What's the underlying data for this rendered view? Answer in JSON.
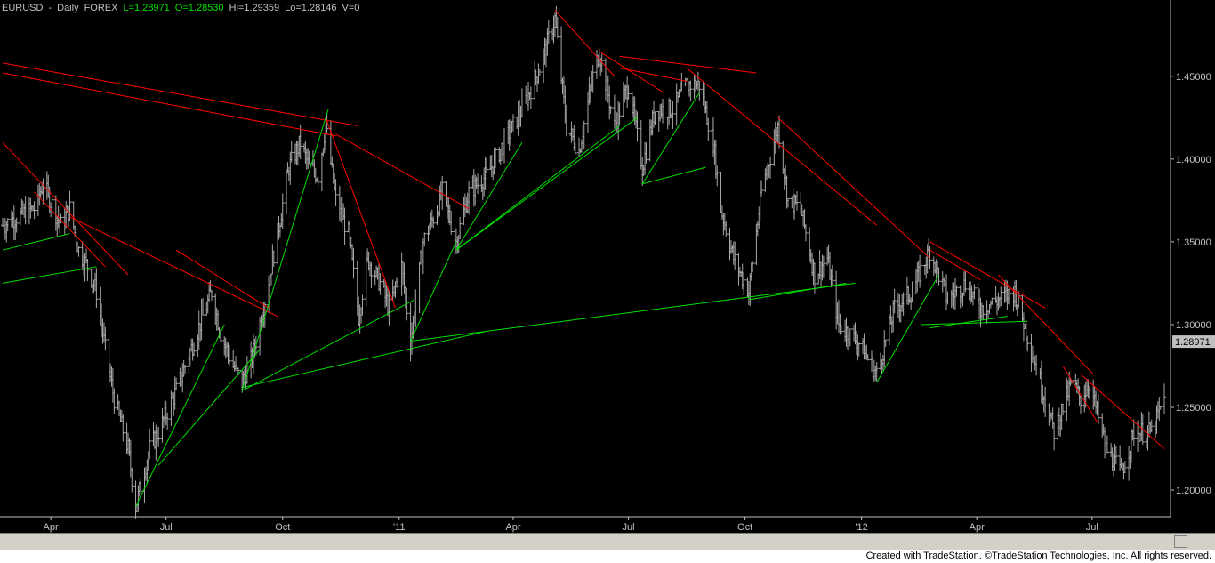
{
  "header": {
    "symbol": "EURUSD",
    "sep1": "-",
    "interval": "Daily",
    "exchange": "FOREX",
    "last": "L=1.28971",
    "open": "O=1.28530",
    "high": "Hi=1.29359",
    "low": "Lo=1.28146",
    "volume": "V=0"
  },
  "footer": {
    "credit": "Created with TradeStation. ©TradeStation Technologies, Inc. All rights reserved."
  },
  "colors": {
    "background": "#000000",
    "bars": "#a8a8a8",
    "resistance": "#ff0000",
    "support": "#00e000",
    "axis": "#c0c0c0"
  },
  "chart_data": {
    "type": "ohlc",
    "title": "",
    "xlabel": "",
    "ylabel": "",
    "ylim": [
      1.185,
      1.495
    ],
    "xlim": [
      "2010-02-22",
      "2012-08-27"
    ],
    "yticks": [
      1.2,
      1.25,
      1.3,
      1.35,
      1.4,
      1.45
    ],
    "ytick_labels": [
      "1.20000",
      "1.25000",
      "1.30000",
      "1.35000",
      "1.40000",
      "1.45000"
    ],
    "last_price_label": "1.28971",
    "last_price": 1.28971,
    "xticks": [
      {
        "date": "2010-04-01",
        "label": "Apr"
      },
      {
        "date": "2010-07-01",
        "label": "Jul"
      },
      {
        "date": "2010-10-01",
        "label": "Oct"
      },
      {
        "date": "2011-01-01",
        "label": "'11"
      },
      {
        "date": "2011-04-01",
        "label": "Apr"
      },
      {
        "date": "2011-07-01",
        "label": "Jul"
      },
      {
        "date": "2011-10-01",
        "label": "Oct"
      },
      {
        "date": "2012-01-01",
        "label": "'12"
      },
      {
        "date": "2012-04-01",
        "label": "Apr"
      },
      {
        "date": "2012-07-01",
        "label": "Jul"
      }
    ],
    "price_path": [
      [
        "2010-02-22",
        1.36
      ],
      [
        "2010-03-05",
        1.365
      ],
      [
        "2010-03-19",
        1.37
      ],
      [
        "2010-03-26",
        1.385
      ],
      [
        "2010-04-09",
        1.36
      ],
      [
        "2010-04-16",
        1.37
      ],
      [
        "2010-04-23",
        1.345
      ],
      [
        "2010-04-30",
        1.335
      ],
      [
        "2010-05-07",
        1.32
      ],
      [
        "2010-05-14",
        1.285
      ],
      [
        "2010-05-21",
        1.255
      ],
      [
        "2010-06-01",
        1.225
      ],
      [
        "2010-06-07",
        1.19
      ],
      [
        "2010-06-18",
        1.225
      ],
      [
        "2010-06-25",
        1.235
      ],
      [
        "2010-07-09",
        1.26
      ],
      [
        "2010-07-23",
        1.29
      ],
      [
        "2010-08-06",
        1.32
      ],
      [
        "2010-08-13",
        1.295
      ],
      [
        "2010-08-23",
        1.275
      ],
      [
        "2010-08-30",
        1.265
      ],
      [
        "2010-09-07",
        1.28
      ],
      [
        "2010-09-17",
        1.315
      ],
      [
        "2010-09-27",
        1.355
      ],
      [
        "2010-10-06",
        1.395
      ],
      [
        "2010-10-15",
        1.41
      ],
      [
        "2010-10-22",
        1.395
      ],
      [
        "2010-10-29",
        1.39
      ],
      [
        "2010-11-04",
        1.42
      ],
      [
        "2010-11-12",
        1.375
      ],
      [
        "2010-11-22",
        1.355
      ],
      [
        "2010-11-30",
        1.305
      ],
      [
        "2010-12-07",
        1.34
      ],
      [
        "2010-12-17",
        1.325
      ],
      [
        "2010-12-24",
        1.31
      ],
      [
        "2011-01-03",
        1.335
      ],
      [
        "2011-01-10",
        1.29
      ],
      [
        "2011-01-20",
        1.35
      ],
      [
        "2011-01-31",
        1.37
      ],
      [
        "2011-02-04",
        1.38
      ],
      [
        "2011-02-15",
        1.35
      ],
      [
        "2011-02-25",
        1.38
      ],
      [
        "2011-03-11",
        1.39
      ],
      [
        "2011-03-25",
        1.41
      ],
      [
        "2011-04-08",
        1.43
      ],
      [
        "2011-04-22",
        1.455
      ],
      [
        "2011-05-04",
        1.485
      ],
      [
        "2011-05-13",
        1.42
      ],
      [
        "2011-05-23",
        1.405
      ],
      [
        "2011-06-03",
        1.45
      ],
      [
        "2011-06-08",
        1.465
      ],
      [
        "2011-06-20",
        1.42
      ],
      [
        "2011-07-01",
        1.445
      ],
      [
        "2011-07-12",
        1.395
      ],
      [
        "2011-07-22",
        1.43
      ],
      [
        "2011-08-05",
        1.43
      ],
      [
        "2011-08-16",
        1.445
      ],
      [
        "2011-08-26",
        1.445
      ],
      [
        "2011-09-06",
        1.41
      ],
      [
        "2011-09-12",
        1.37
      ],
      [
        "2011-09-22",
        1.34
      ],
      [
        "2011-10-04",
        1.32
      ],
      [
        "2011-10-14",
        1.38
      ],
      [
        "2011-10-27",
        1.42
      ],
      [
        "2011-11-04",
        1.375
      ],
      [
        "2011-11-14",
        1.37
      ],
      [
        "2011-11-25",
        1.33
      ],
      [
        "2011-12-05",
        1.34
      ],
      [
        "2011-12-14",
        1.3
      ],
      [
        "2011-12-29",
        1.29
      ],
      [
        "2012-01-13",
        1.27
      ],
      [
        "2012-01-27",
        1.31
      ],
      [
        "2012-02-10",
        1.32
      ],
      [
        "2012-02-24",
        1.345
      ],
      [
        "2012-03-09",
        1.315
      ],
      [
        "2012-03-23",
        1.325
      ],
      [
        "2012-04-04",
        1.31
      ],
      [
        "2012-04-18",
        1.315
      ],
      [
        "2012-05-01",
        1.32
      ],
      [
        "2012-05-14",
        1.285
      ],
      [
        "2012-05-25",
        1.255
      ],
      [
        "2012-06-01",
        1.235
      ],
      [
        "2012-06-15",
        1.265
      ],
      [
        "2012-06-22",
        1.255
      ],
      [
        "2012-06-29",
        1.265
      ],
      [
        "2012-07-12",
        1.225
      ],
      [
        "2012-07-24",
        1.21
      ],
      [
        "2012-08-03",
        1.235
      ],
      [
        "2012-08-17",
        1.235
      ],
      [
        "2012-08-27",
        1.255
      ]
    ],
    "trendlines": {
      "resistance": [
        [
          [
            "2010-02-22",
            1.458
          ],
          [
            "2010-11-30",
            1.42
          ]
        ],
        [
          [
            "2010-02-22",
            1.452
          ],
          [
            "2010-11-12",
            1.414
          ]
        ],
        [
          [
            "2010-02-22",
            1.41
          ],
          [
            "2010-06-01",
            1.33
          ]
        ],
        [
          [
            "2010-03-19",
            1.38
          ],
          [
            "2010-05-14",
            1.335
          ]
        ],
        [
          [
            "2010-04-16",
            1.365
          ],
          [
            "2010-09-27",
            1.305
          ]
        ],
        [
          [
            "2010-07-09",
            1.345
          ],
          [
            "2010-09-20",
            1.31
          ]
        ],
        [
          [
            "2010-11-04",
            1.425
          ],
          [
            "2010-12-29",
            1.31
          ]
        ],
        [
          [
            "2010-11-12",
            1.415
          ],
          [
            "2011-02-25",
            1.37
          ]
        ],
        [
          [
            "2011-05-04",
            1.49
          ],
          [
            "2011-06-20",
            1.45
          ]
        ],
        [
          [
            "2011-06-08",
            1.465
          ],
          [
            "2011-07-29",
            1.44
          ]
        ],
        [
          [
            "2011-06-24",
            1.455
          ],
          [
            "2011-08-16",
            1.447
          ]
        ],
        [
          [
            "2011-06-24",
            1.462
          ],
          [
            "2011-10-10",
            1.452
          ]
        ],
        [
          [
            "2011-08-16",
            1.455
          ],
          [
            "2012-01-13",
            1.36
          ]
        ],
        [
          [
            "2011-10-27",
            1.425
          ],
          [
            "2012-02-24",
            1.34
          ]
        ],
        [
          [
            "2012-02-24",
            1.35
          ],
          [
            "2012-05-25",
            1.31
          ]
        ],
        [
          [
            "2012-02-24",
            1.345
          ],
          [
            "2012-04-04",
            1.327
          ]
        ],
        [
          [
            "2012-04-18",
            1.33
          ],
          [
            "2012-07-02",
            1.27
          ]
        ],
        [
          [
            "2012-06-08",
            1.275
          ],
          [
            "2012-07-06",
            1.24
          ]
        ],
        [
          [
            "2012-06-22",
            1.27
          ],
          [
            "2012-08-27",
            1.225
          ]
        ]
      ],
      "support": [
        [
          [
            "2010-02-22",
            1.345
          ],
          [
            "2010-04-16",
            1.355
          ]
        ],
        [
          [
            "2010-02-22",
            1.325
          ],
          [
            "2010-05-07",
            1.335
          ]
        ],
        [
          [
            "2010-06-07",
            1.19
          ],
          [
            "2010-08-16",
            1.3
          ]
        ],
        [
          [
            "2010-06-25",
            1.215
          ],
          [
            "2010-09-13",
            1.285
          ]
        ],
        [
          [
            "2010-08-30",
            1.26
          ],
          [
            "2011-01-13",
            1.315
          ]
        ],
        [
          [
            "2010-08-30",
            1.262
          ],
          [
            "2011-03-11",
            1.296
          ]
        ],
        [
          [
            "2010-08-30",
            1.26
          ],
          [
            "2010-11-06",
            1.43
          ]
        ],
        [
          [
            "2011-01-10",
            1.29
          ],
          [
            "2011-02-15",
            1.35
          ]
        ],
        [
          [
            "2011-01-10",
            1.29
          ],
          [
            "2011-12-27",
            1.325
          ]
        ],
        [
          [
            "2011-02-15",
            1.345
          ],
          [
            "2011-04-08",
            1.41
          ]
        ],
        [
          [
            "2011-02-15",
            1.345
          ],
          [
            "2011-07-08",
            1.425
          ]
        ],
        [
          [
            "2011-02-15",
            1.345
          ],
          [
            "2011-06-24",
            1.42
          ]
        ],
        [
          [
            "2011-07-12",
            1.385
          ],
          [
            "2011-08-31",
            1.395
          ]
        ],
        [
          [
            "2011-07-12",
            1.385
          ],
          [
            "2011-08-26",
            1.44
          ]
        ],
        [
          [
            "2011-10-04",
            1.315
          ],
          [
            "2011-12-20",
            1.325
          ]
        ],
        [
          [
            "2012-01-13",
            1.265
          ],
          [
            "2012-03-02",
            1.33
          ]
        ],
        [
          [
            "2012-02-17",
            1.3
          ],
          [
            "2012-05-11",
            1.302
          ]
        ],
        [
          [
            "2012-02-24",
            1.298
          ],
          [
            "2012-04-25",
            1.305
          ]
        ]
      ]
    },
    "grid": false,
    "legend": "none"
  }
}
